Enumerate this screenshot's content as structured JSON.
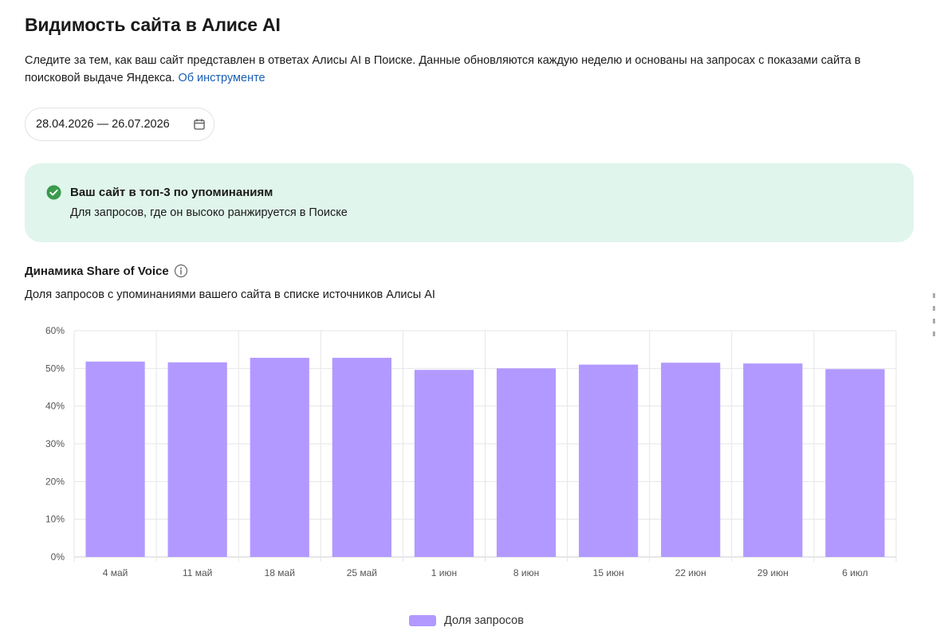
{
  "page": {
    "title": "Видимость сайта в Алисе AI",
    "description_text": "Следите за тем, как ваш сайт представлен в ответах Алисы AI в Поиске. Данные обновляются каждую неделю и основаны на запросах с показами сайта в поисковой выдаче Яндекса.",
    "description_link": "Об инструменте"
  },
  "date_picker": {
    "value": "28.04.2026 — 26.07.2026",
    "icon": "calendar-icon"
  },
  "banner": {
    "icon": "check-circle-icon",
    "title": "Ваш сайт в топ-3 по упоминаниям",
    "subtitle": "Для запросов, где он высоко ранжируется в Поиске",
    "background_color": "#e0f5ec",
    "icon_color": "#2ea44f"
  },
  "section": {
    "title": "Динамика Share of Voice",
    "subtitle": "Доля запросов с упоминаниями вашего сайта в списке источников Алисы AI",
    "info_icon": "info-icon"
  },
  "chart_data": {
    "type": "bar",
    "categories": [
      "4 май",
      "11 май",
      "18 май",
      "25 май",
      "1 июн",
      "8 июн",
      "15 июн",
      "22 июн",
      "29 июн",
      "6 июл"
    ],
    "series": [
      {
        "name": "Доля запросов",
        "values": [
          51.8,
          51.6,
          52.8,
          52.8,
          49.6,
          50.0,
          51.0,
          51.5,
          51.3,
          49.8
        ],
        "color": "#b299ff"
      }
    ],
    "y_ticks": [
      "0%",
      "10%",
      "20%",
      "30%",
      "40%",
      "50%",
      "60%"
    ],
    "ylim": [
      0,
      60
    ],
    "grid": true,
    "legend_position": "bottom-center"
  },
  "legend": {
    "label": "Доля запросов"
  }
}
